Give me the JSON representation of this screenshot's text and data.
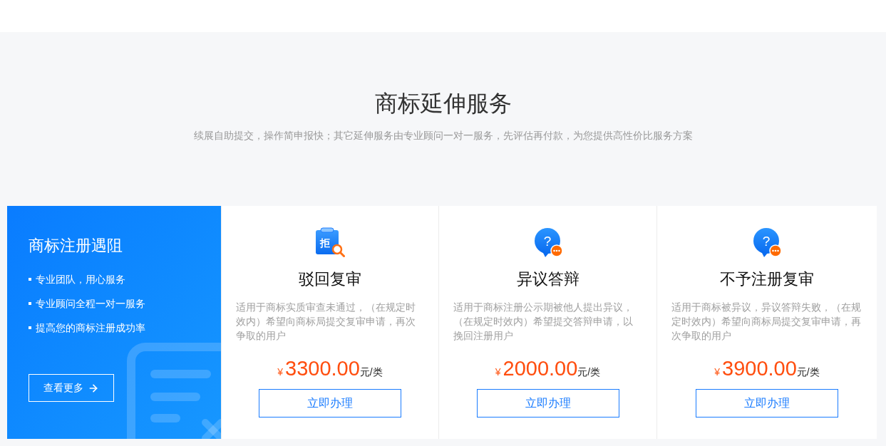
{
  "header": {
    "title": "商标延伸服务",
    "subtitle": "续展自助提交，操作简申报快；其它延伸服务由专业顾问一对一服务，先评估再付款，为您提供高性价比服务方案"
  },
  "promo": {
    "title": "商标注册遇阻",
    "bullets": [
      "专业团队，用心服务",
      "专业顾问全程一对一服务",
      "提高您的商标注册成功率"
    ],
    "button": "查看更多"
  },
  "services": [
    {
      "kind": "clipboard",
      "icon_glyph": "拒",
      "title": "驳回复审",
      "description": "适用于商标实质审查未通过，（在规定时效内）希望向商标局提交复审申请，再次争取的用户",
      "currency": "¥",
      "price": "3300.00",
      "unit": "元/类",
      "button": "立即办理"
    },
    {
      "kind": "bubble",
      "icon_glyph": "?",
      "title": "异议答辩",
      "description": "适用于商标注册公示期被他人提出异议，（在规定时效内）希望提交答辩申请，以挽回注册用户",
      "currency": "¥",
      "price": "2000.00",
      "unit": "元/类",
      "button": "立即办理"
    },
    {
      "kind": "bubble",
      "icon_glyph": "?",
      "title": "不予注册复审",
      "description": "适用于商标被异议，异议答辩失败，（在规定时效内）希望向商标局提交复审申请，再次争取的用户",
      "currency": "¥",
      "price": "3900.00",
      "unit": "元/类",
      "button": "立即办理"
    }
  ]
}
